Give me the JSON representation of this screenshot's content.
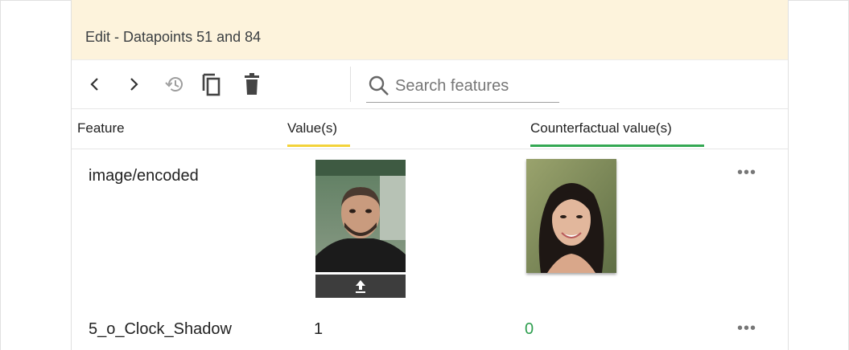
{
  "header": {
    "title": "Edit - Datapoints 51 and 84"
  },
  "toolbar": {
    "prev_icon": "chevron-left-icon",
    "next_icon": "chevron-right-icon",
    "history_icon": "history-icon",
    "copy_icon": "copy-icon",
    "delete_icon": "trash-icon"
  },
  "search": {
    "placeholder": "Search features",
    "value": ""
  },
  "columns": {
    "feature": "Feature",
    "values": "Value(s)",
    "counterfactual": "Counterfactual value(s)"
  },
  "colors": {
    "value_accent": "#f3d33a",
    "counterfactual_accent": "#34a853",
    "header_bg": "#fdf3dc"
  },
  "rows": [
    {
      "feature": "image/encoded",
      "value_type": "image",
      "counterfactual_type": "image"
    },
    {
      "feature": "5_o_Clock_Shadow",
      "value": "1",
      "counterfactual": "0"
    }
  ],
  "more_glyph": "•••"
}
